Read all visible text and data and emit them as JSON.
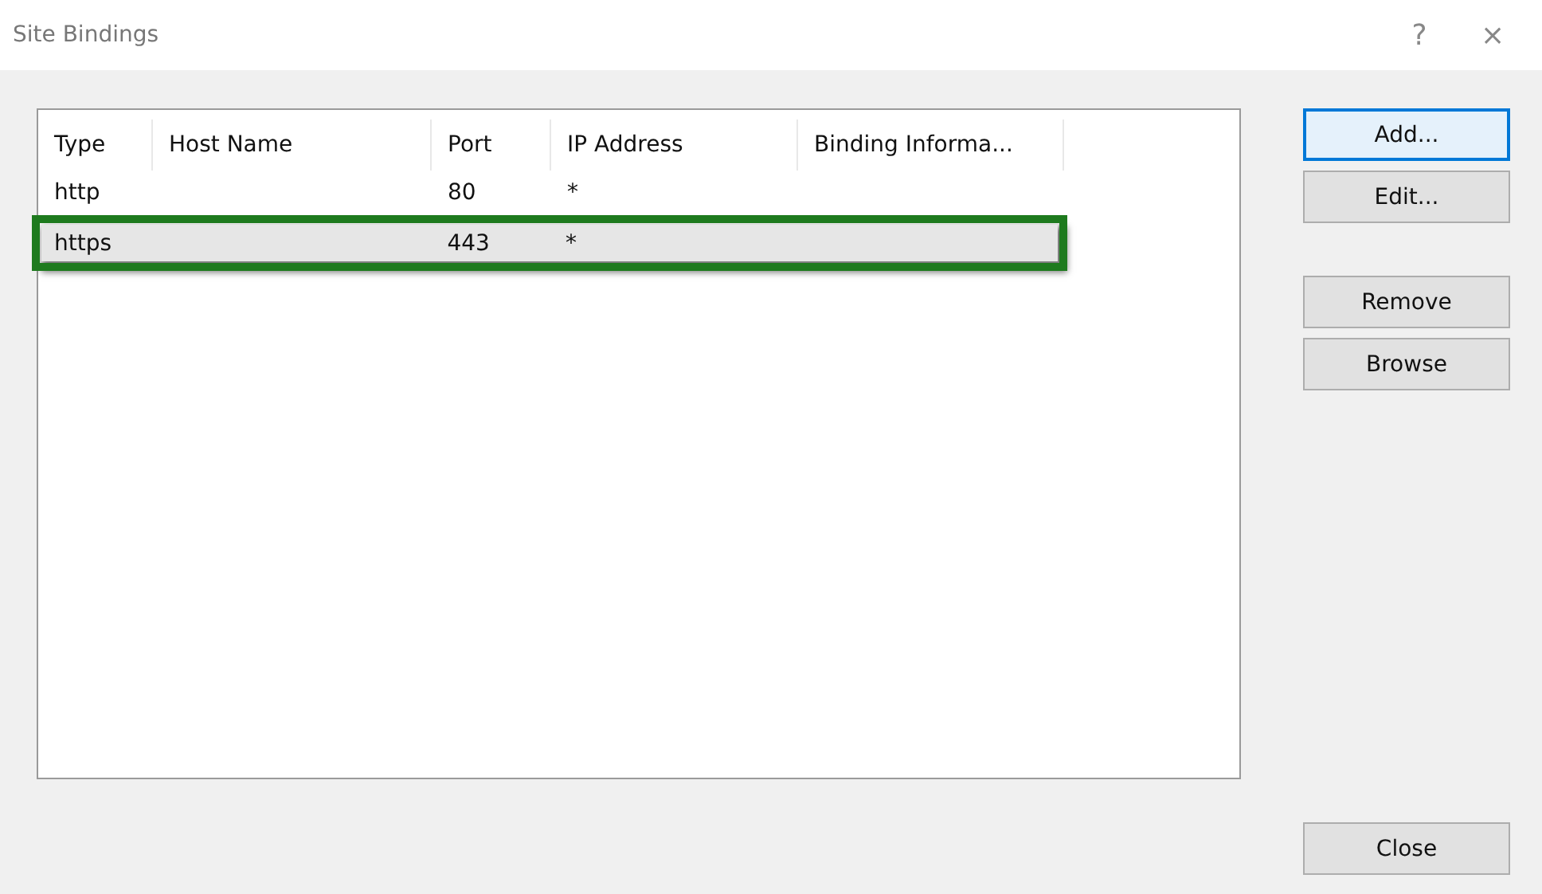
{
  "window": {
    "title": "Site Bindings",
    "help": "?",
    "close": "×"
  },
  "table": {
    "columns": [
      "Type",
      "Host Name",
      "Port",
      "IP Address",
      "Binding Informa..."
    ],
    "rows": [
      {
        "cells": [
          "http",
          "",
          "80",
          "*",
          ""
        ],
        "selected": false,
        "highlighted": false
      },
      {
        "cells": [
          "https",
          "",
          "443",
          "*",
          ""
        ],
        "selected": true,
        "highlighted": true
      }
    ]
  },
  "buttons": [
    {
      "label": "Add...",
      "default": true
    },
    {
      "label": "Edit...",
      "default": false
    },
    {
      "label": "Remove",
      "default": false
    },
    {
      "label": "Browse",
      "default": false
    }
  ],
  "close_button": {
    "label": "Close"
  }
}
